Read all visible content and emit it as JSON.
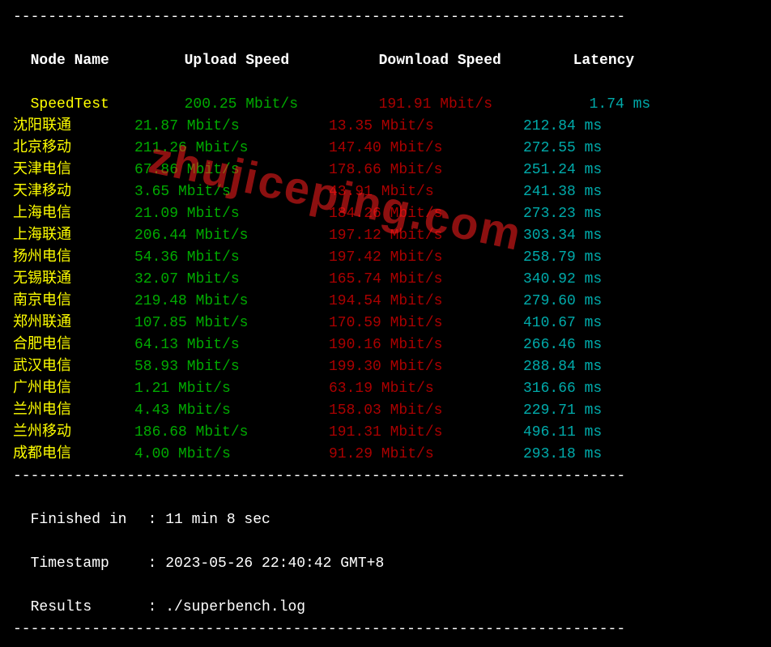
{
  "headers": {
    "node": "Node Name",
    "upload": "Upload Speed",
    "download": "Download Speed",
    "latency": "Latency"
  },
  "speedtest_row": {
    "node": "SpeedTest",
    "upload": "200.25 Mbit/s",
    "download": "191.91 Mbit/s",
    "latency": "1.74 ms"
  },
  "rows": [
    {
      "node": "沈阳联通",
      "upload": "21.87 Mbit/s",
      "download": "13.35 Mbit/s",
      "latency": "212.84 ms"
    },
    {
      "node": "北京移动",
      "upload": "211.26 Mbit/s",
      "download": "147.40 Mbit/s",
      "latency": "272.55 ms"
    },
    {
      "node": "天津电信",
      "upload": "67.86 Mbit/s",
      "download": "178.66 Mbit/s",
      "latency": "251.24 ms"
    },
    {
      "node": "天津移动",
      "upload": "3.65 Mbit/s",
      "download": "43.91 Mbit/s",
      "latency": "241.38 ms"
    },
    {
      "node": "上海电信",
      "upload": "21.09 Mbit/s",
      "download": "184.26 Mbit/s",
      "latency": "273.23 ms"
    },
    {
      "node": "上海联通",
      "upload": "206.44 Mbit/s",
      "download": "197.12 Mbit/s",
      "latency": "303.34 ms"
    },
    {
      "node": "扬州电信",
      "upload": "54.36 Mbit/s",
      "download": "197.42 Mbit/s",
      "latency": "258.79 ms"
    },
    {
      "node": "无锡联通",
      "upload": "32.07 Mbit/s",
      "download": "165.74 Mbit/s",
      "latency": "340.92 ms"
    },
    {
      "node": "南京电信",
      "upload": "219.48 Mbit/s",
      "download": "194.54 Mbit/s",
      "latency": "279.60 ms"
    },
    {
      "node": "郑州联通",
      "upload": "107.85 Mbit/s",
      "download": "170.59 Mbit/s",
      "latency": "410.67 ms"
    },
    {
      "node": "合肥电信",
      "upload": "64.13 Mbit/s",
      "download": "190.16 Mbit/s",
      "latency": "266.46 ms"
    },
    {
      "node": "武汉电信",
      "upload": "58.93 Mbit/s",
      "download": "199.30 Mbit/s",
      "latency": "288.84 ms"
    },
    {
      "node": "广州电信",
      "upload": "1.21 Mbit/s",
      "download": "63.19 Mbit/s",
      "latency": "316.66 ms"
    },
    {
      "node": "兰州电信",
      "upload": "4.43 Mbit/s",
      "download": "158.03 Mbit/s",
      "latency": "229.71 ms"
    },
    {
      "node": "兰州移动",
      "upload": "186.68 Mbit/s",
      "download": "191.31 Mbit/s",
      "latency": "496.11 ms"
    },
    {
      "node": "成都电信",
      "upload": "4.00 Mbit/s",
      "download": "91.29 Mbit/s",
      "latency": "293.18 ms"
    }
  ],
  "footer": {
    "finished_label": "Finished in",
    "finished_value": "11 min 8 sec",
    "timestamp_label": "Timestamp",
    "timestamp_value": "2023-05-26 22:40:42 GMT+8",
    "results_label": "Results",
    "results_value": "./superbench.log"
  },
  "divider": "----------------------------------------------------------------------",
  "watermark": "zhujiceping.com"
}
